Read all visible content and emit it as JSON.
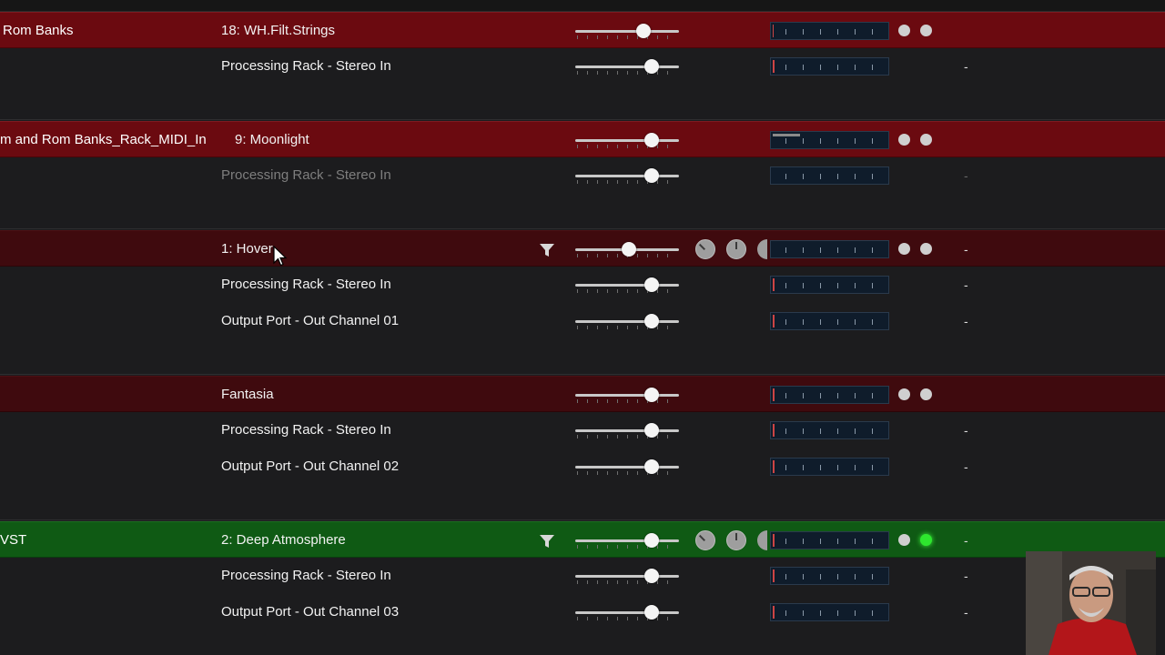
{
  "rows": [
    {
      "source": "Rom Banks",
      "name": "18: WH.Filt.Strings",
      "slider": 0.66,
      "dash": ""
    },
    {
      "source": "",
      "name": "Processing Rack - Stereo In",
      "slider": 0.74,
      "dash": "-"
    },
    {
      "source": "m and Rom Banks_Rack_MIDI_In",
      "name": "9: Moonlight",
      "slider": 0.74,
      "dash": ""
    },
    {
      "source": "",
      "name": "Processing Rack - Stereo In",
      "slider": 0.74,
      "dash": "-"
    },
    {
      "source": "",
      "name": "1: Hover",
      "slider": 0.52,
      "dash": "-"
    },
    {
      "source": "",
      "name": "Processing Rack - Stereo In",
      "slider": 0.74,
      "dash": "-"
    },
    {
      "source": "",
      "name": "Output Port - Out Channel 01",
      "slider": 0.74,
      "dash": "-"
    },
    {
      "source": "",
      "name": "Fantasia",
      "slider": 0.74,
      "dash": ""
    },
    {
      "source": "",
      "name": "Processing Rack - Stereo In",
      "slider": 0.74,
      "dash": "-"
    },
    {
      "source": "",
      "name": "Output Port - Out Channel 02",
      "slider": 0.74,
      "dash": "-"
    },
    {
      "source": "VST",
      "name": "2: Deep Atmosphere",
      "slider": 0.74,
      "dash": "-"
    },
    {
      "source": "",
      "name": "Processing Rack - Stereo In",
      "slider": 0.74,
      "dash": "-"
    },
    {
      "source": "",
      "name": "Output Port - Out Channel 03",
      "slider": 0.74,
      "dash": "-"
    }
  ],
  "icons": {
    "filter": "filter-icon",
    "knob": "knob-icon",
    "dot": "led-icon",
    "cursor": "mouse-cursor-icon"
  },
  "colors": {
    "track_red": "#6b0a10",
    "track_darkred": "#3f0a0e",
    "track_green": "#0f5a14",
    "led_active": "#2ee62e"
  }
}
